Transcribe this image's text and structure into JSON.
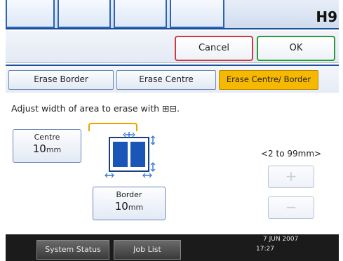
{
  "header": {
    "badge": "H9"
  },
  "actions": {
    "cancel": "Cancel",
    "ok": "OK"
  },
  "modes": {
    "erase_border": "Erase Border",
    "erase_centre": "Erase Centre",
    "erase_centre_border": "Erase Centre/ Border",
    "selected": "Erase Centre/ Border"
  },
  "instruction": "Adjust width of area to erase with ⊞⊟.",
  "centre": {
    "label": "Centre",
    "value": "10",
    "unit": "mm"
  },
  "border": {
    "label": "Border",
    "value": "10",
    "unit": "mm"
  },
  "range": "<2 to 99mm>",
  "stepper": {
    "plus": "+",
    "minus": "−"
  },
  "footer": {
    "system_status": "System Status",
    "job_list": "Job List",
    "date": "7  JUN   2007",
    "time": "17:27"
  },
  "colors": {
    "accent_blue": "#1e4f9a",
    "selected_orange": "#f7b800",
    "cancel_red": "#cc3b3b",
    "ok_green": "#2f9a3a"
  }
}
